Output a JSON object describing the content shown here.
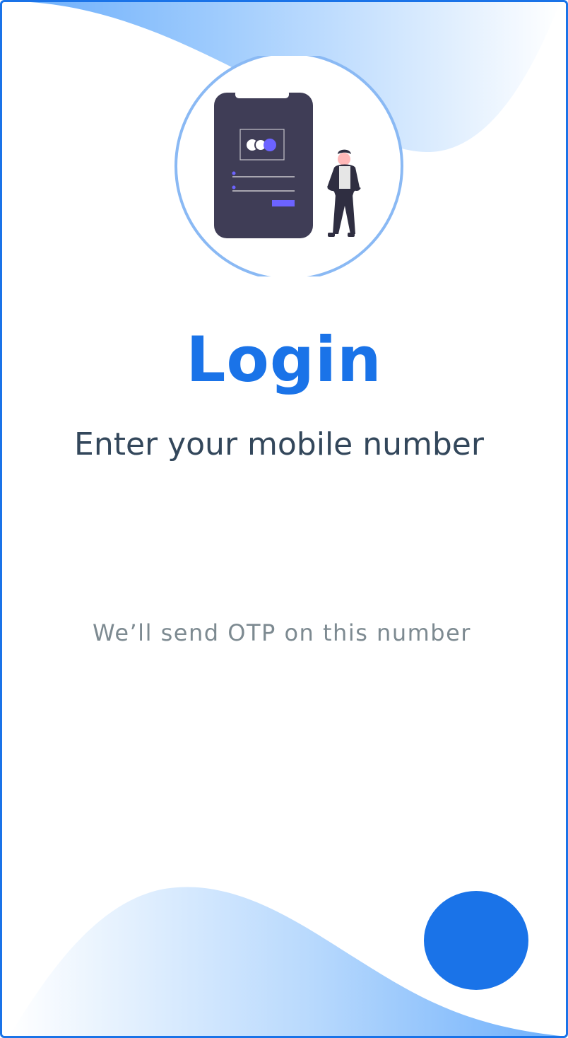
{
  "login": {
    "title": "Login",
    "subtitle": "Enter your mobile number",
    "mobile_value": "",
    "mobile_placeholder": "",
    "otp_hint": "We’ll send OTP on this number"
  },
  "icons": {
    "illustration": "phone-login-illustration-icon",
    "next": "next-button"
  },
  "colors": {
    "accent": "#1a73e8",
    "heading_text": "#33475b",
    "hint_text": "#7d8a91",
    "wave_light": "#eaf3fe",
    "wave_mid": "#9ecbfd",
    "phone_body": "#3f3d56",
    "phone_accent": "#6c63ff"
  }
}
